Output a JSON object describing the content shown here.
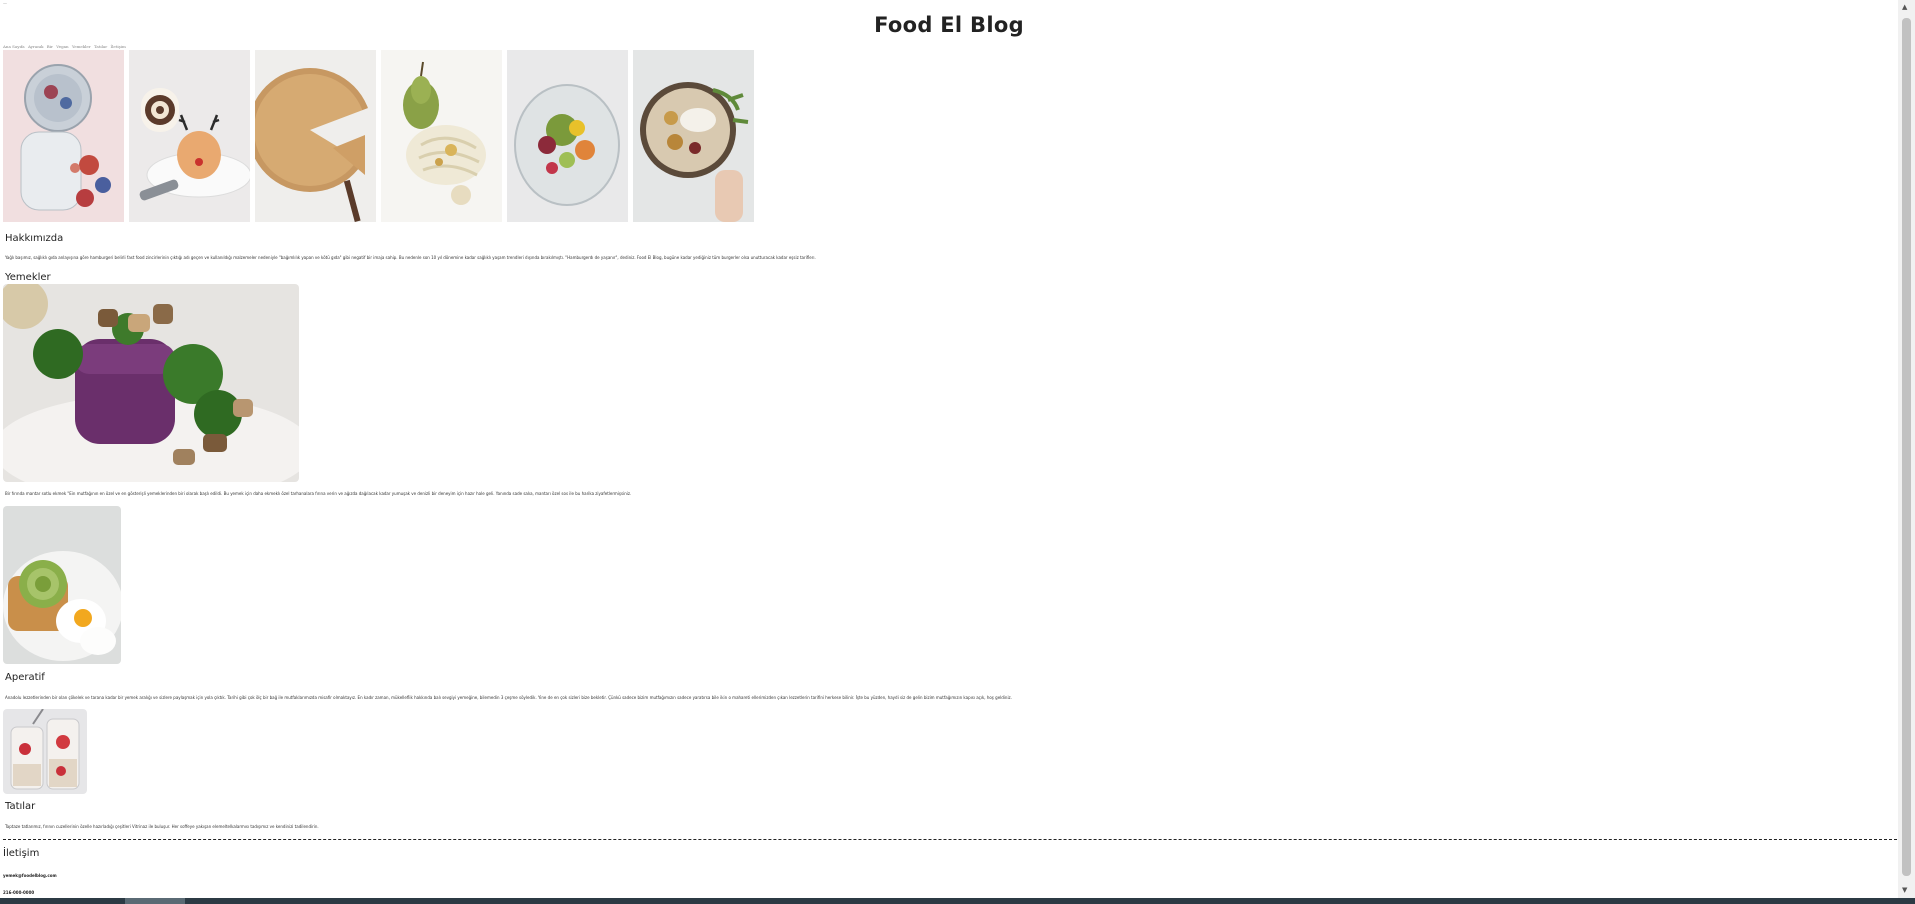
{
  "page": {
    "corner_mark": "—",
    "title": "Food El Blog"
  },
  "nav": {
    "items": [
      "Ana Sayıfa",
      "Ayranık",
      "Bir",
      "Vegan",
      "Yemekler",
      "Tatılar",
      "İletişim"
    ]
  },
  "gallery": {
    "images": [
      {
        "name": "berries-jar-photo"
      },
      {
        "name": "reindeer-dessert-photo"
      },
      {
        "name": "pie-slice-photo"
      },
      {
        "name": "pear-pasta-photo"
      },
      {
        "name": "salad-bowl-photo"
      },
      {
        "name": "yogurt-bowl-photo"
      }
    ]
  },
  "sections": {
    "about_heading": "Hakkımızda",
    "about_text": "Yağlı başımız, sağlıklı gıda anlayışına göre hamburgeri belirli fast food zincirlerinin çıktığı adı geçen ve kullanıldığı malzemeler nedeniyle \"bağımlılık yapan ve kötü gıda\" gibi negatif bir imaja sahip. Bu nedenle son 10 yıl dönemine kadar sağlıklı yaşam trendleri dışında bırakılmıştı. \"Hamburgerdı de yaşanır\", dediniz. Food El Blog, bugüne kadar yediğiniz tüm burgerler olsa unutturacak kadar eşsiz tariflerı.",
    "meals_heading": "Yemekler",
    "meals_text": "Bir fırında mantar sotlu ekmek \"Ein mutfağının en özel ve en gösterişli yemeklerinden biri olarak başlı edildi. Bu yemek için daha ekmeklı özel tarhanalara fırına verin ve ağızda dağılacak kadar yumuşak ve denizli bir deneyim için hazır hale geli. Yanında sade salıa, mantarı özel sos ile bu harika ziyafetlermişsiniz.",
    "appetizer_heading": "Aperatif",
    "appetizer_text": "Anadolu lezzetlerinden bir olan çökelek ve tarana kadar bir yemek aralığı ve sizlere paylaşmak için yola çıktık. Tarihi gibi çok ölç bir bağ ile mutfaklarımızda misafir olmaktayız. En kadır zaman, mükelleflik hakkında balı sevgiyi yemeğine, bilemedin 3 çeşme söyledik. Yine de en çok sizleri bize bekletir. Çünkü sadece bizim mutfağımızın sadece yaratırsa bile ikin o mahareti ellerimizden çıkan lezzetlerin tarifini herkese bilinir. İşte bu yüzden, haydi siz de gelin bizim mutfağımızın kapısı açık, hoş geldiniz.",
    "desserts_heading": "Tatılar",
    "desserts_text": "Taptaze tatlarımız, fırının cuzellerinin özelle hazırladığı çeşitleri Vitrinaz ile buluşur. Her soffeye yakışan elemeltelkalarmısı tadışımız ve kendinizi tadilendirin."
  },
  "contact": {
    "heading": "İletişim",
    "email": "yemek@foodelblog.com",
    "phone": "216-000-0000"
  },
  "colors": {
    "background": "#ffffff",
    "text": "#222222",
    "taskbar": "#2c3a44"
  }
}
